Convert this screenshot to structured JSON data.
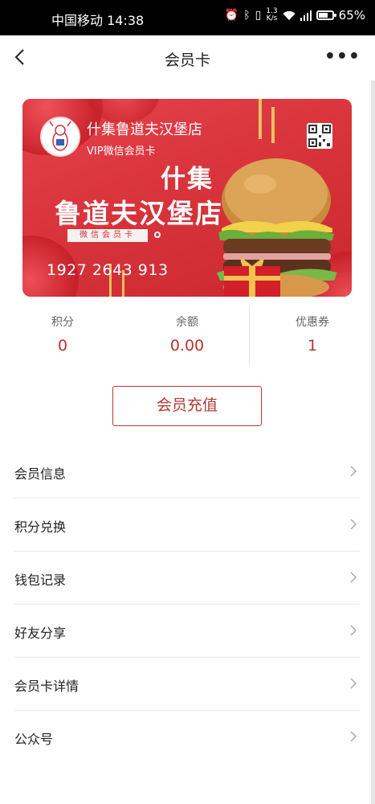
{
  "status_bar": {
    "carrier_time": "中国移动 14:38",
    "speed_value": "1.3",
    "speed_unit": "K/s",
    "battery": "65%",
    "icons": [
      "alarm-icon",
      "bluetooth-icon",
      "vibrate-icon",
      "wifi-icon",
      "signal-icon",
      "battery-icon"
    ]
  },
  "header": {
    "title": "会员卡",
    "more": "•••"
  },
  "card": {
    "shop_name": "什集鲁道夫汉堡店",
    "vip_label": "VIP微信会员卡",
    "headline_line1": "什集",
    "headline_line2": "鲁道夫汉堡店",
    "badge_text": "微信会员卡",
    "card_number": "1927 2643 913",
    "colors": {
      "primary": "#d9343c",
      "accent": "#b9322d"
    }
  },
  "stats": [
    {
      "label": "积分",
      "value": "0"
    },
    {
      "label": "余额",
      "value": "0.00"
    },
    {
      "label": "优惠券",
      "value": "1"
    }
  ],
  "recharge_button": "会员充值",
  "menu": [
    {
      "label": "会员信息"
    },
    {
      "label": "积分兑换"
    },
    {
      "label": "钱包记录"
    },
    {
      "label": "好友分享"
    },
    {
      "label": "会员卡详情"
    },
    {
      "label": "公众号"
    }
  ]
}
